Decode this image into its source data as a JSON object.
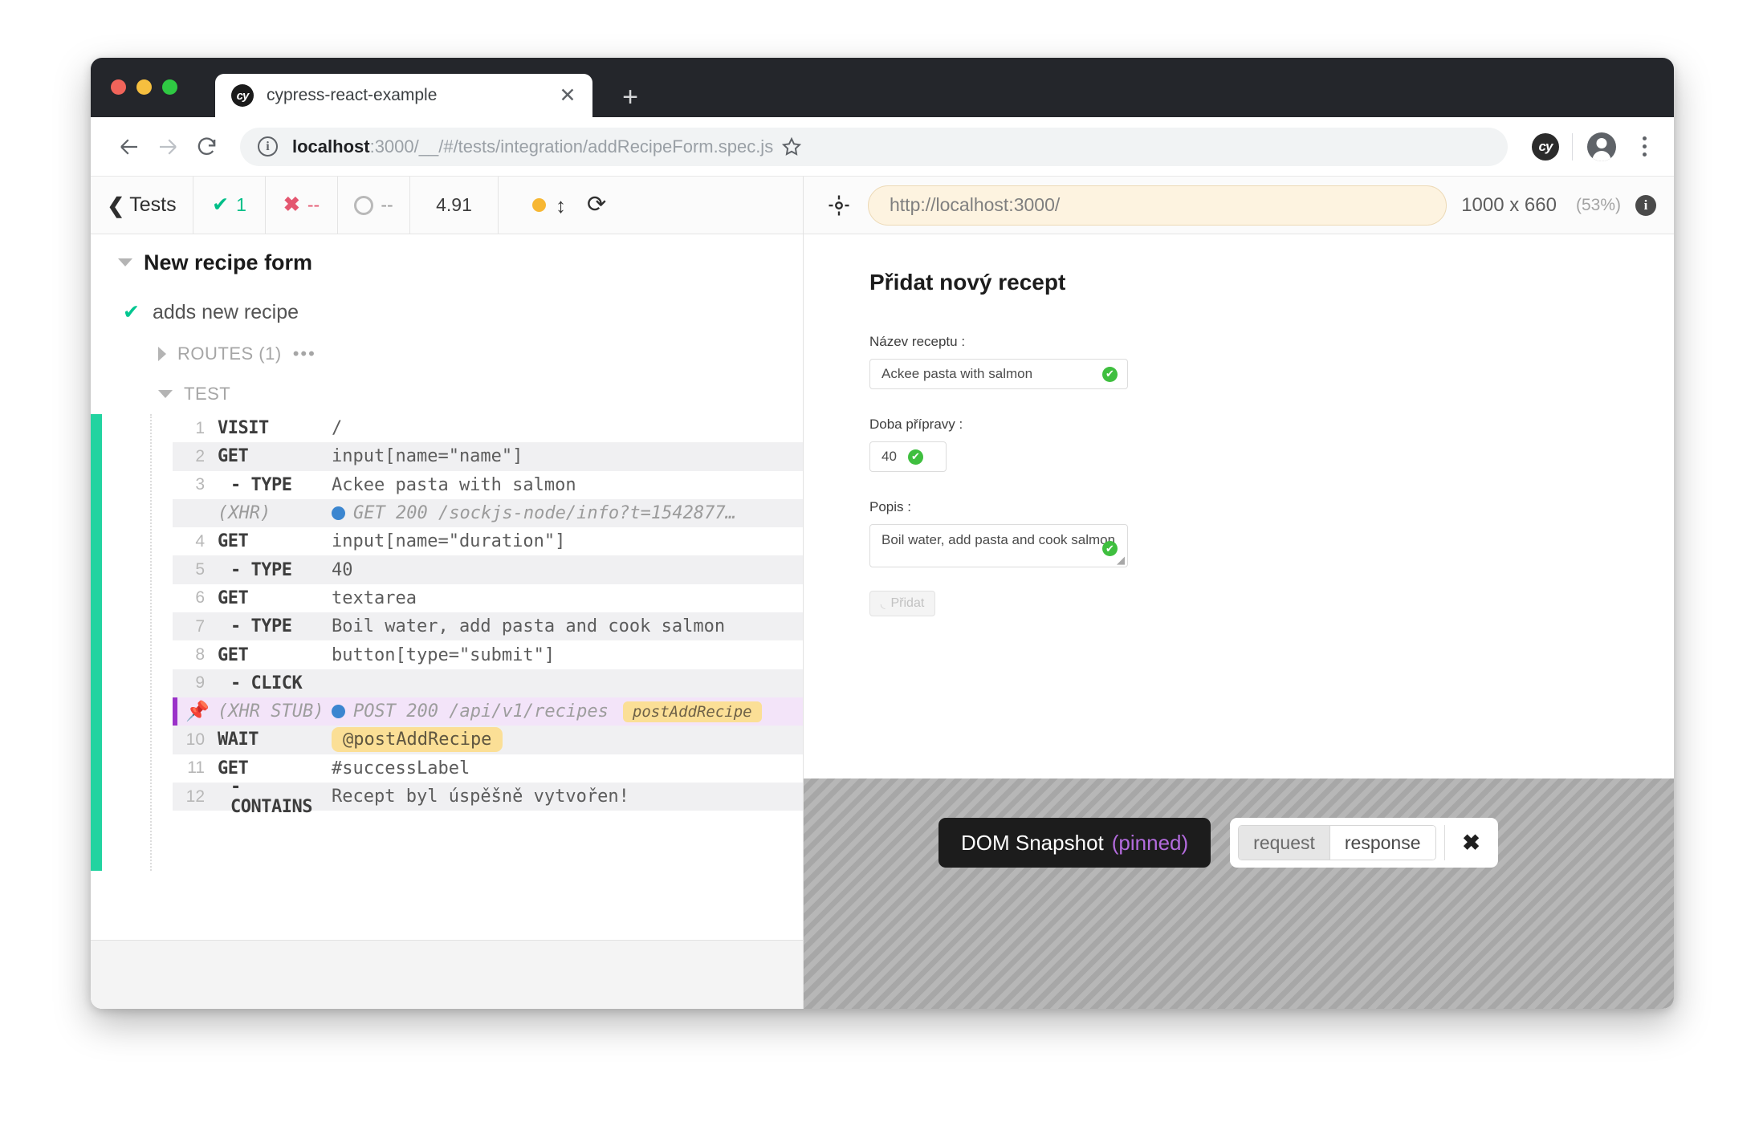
{
  "browser": {
    "tab": {
      "title": "cypress-react-example",
      "favicon": "cy",
      "close_icon": "close-icon"
    },
    "new_tab_label": "+",
    "url_host": "localhost",
    "url_rest": ":3000/__/#/tests/integration/addRecipeForm.spec.js",
    "extension_icon": "cy"
  },
  "runner": {
    "back_label": "Tests",
    "stats": {
      "passed": "1",
      "failed": "--",
      "pending": "--",
      "duration": "4.91"
    },
    "spec": {
      "suite": "New recipe form",
      "test": "adds new recipe",
      "routes_label": "ROUTES (1)",
      "test_label": "TEST"
    },
    "commands": [
      {
        "num": "1",
        "name": "VISIT",
        "message": "/",
        "type": "cmd",
        "nested": false
      },
      {
        "num": "2",
        "name": "GET",
        "message": "input[name=\"name\"]",
        "type": "cmd",
        "nested": false
      },
      {
        "num": "3",
        "name": "- TYPE",
        "message": "Ackee pasta with salmon",
        "type": "cmd",
        "nested": true
      },
      {
        "num": "",
        "name": "(XHR)",
        "message": "GET 200 /sockjs-node/info?t=1542877…",
        "type": "xhr",
        "nested": false
      },
      {
        "num": "4",
        "name": "GET",
        "message": "input[name=\"duration\"]",
        "type": "cmd",
        "nested": false
      },
      {
        "num": "5",
        "name": "- TYPE",
        "message": "40",
        "type": "cmd",
        "nested": true
      },
      {
        "num": "6",
        "name": "GET",
        "message": "textarea",
        "type": "cmd",
        "nested": false
      },
      {
        "num": "7",
        "name": "- TYPE",
        "message": "Boil water, add pasta and cook salmon",
        "type": "cmd",
        "nested": true
      },
      {
        "num": "8",
        "name": "GET",
        "message": "button[type=\"submit\"]",
        "type": "cmd",
        "nested": false
      },
      {
        "num": "9",
        "name": "- CLICK",
        "message": "",
        "type": "cmd",
        "nested": true
      },
      {
        "num": "📌",
        "name": "(XHR STUB)",
        "message": "POST 200 /api/v1/recipes",
        "type": "stub",
        "alias": "postAddRecipe",
        "nested": false
      },
      {
        "num": "10",
        "name": "WAIT",
        "message": "@postAddRecipe",
        "type": "alias",
        "nested": false
      },
      {
        "num": "11",
        "name": "GET",
        "message": "#successLabel",
        "type": "cmd",
        "nested": false
      },
      {
        "num": "12",
        "name": "- CONTAINS",
        "message": "Recept byl úspěšně vytvořen!",
        "type": "cmd",
        "nested": true
      }
    ]
  },
  "viewport_bar": {
    "url": "http://localhost:3000/",
    "size": "1000 x 660",
    "scale": "(53%)"
  },
  "app": {
    "title": "Přidat nový recept",
    "name_label": "Název receptu :",
    "name_value": "Ackee pasta with salmon",
    "duration_label": "Doba přípravy :",
    "duration_value": "40",
    "description_label": "Popis :",
    "description_value": "Boil water, add pasta and cook salmon",
    "submit_label": "Přidat",
    "valid_icon": "✔"
  },
  "snapshot": {
    "label": "DOM Snapshot",
    "pinned": "(pinned)",
    "tab_request": "request",
    "tab_response": "response",
    "close": "✖"
  },
  "colors": {
    "green": "#00bf88",
    "red": "#e45770",
    "purple": "#9b32c9",
    "alias_yellow": "#fbdf96",
    "status_bar_green": "#22d3a0"
  }
}
